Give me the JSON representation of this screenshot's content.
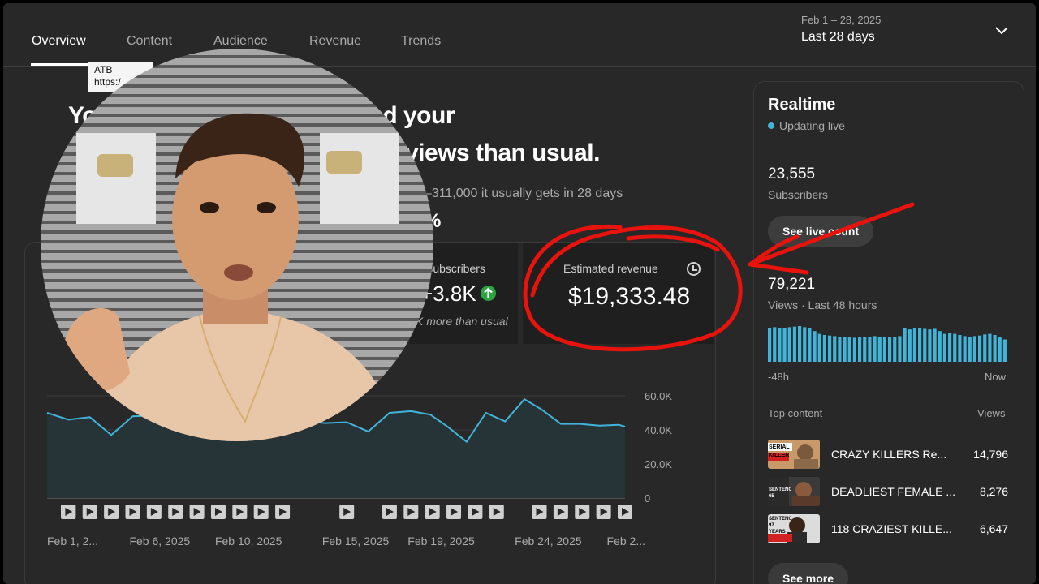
{
  "tabs": [
    {
      "label": "Overview"
    },
    {
      "label": "Content"
    },
    {
      "label": "Audience"
    },
    {
      "label": "Revenue"
    },
    {
      "label": "Trends"
    }
  ],
  "date_range": {
    "sub": "Feb 1 – 28, 2025",
    "main": "Last 28 days"
  },
  "tooltip": {
    "line1": "ATB",
    "line2": "https:/"
  },
  "headline": {
    "line1": "Yo          blishing more helped your",
    "line2": "views than usual.",
    "sub": "0–311,000 it usually gets in 28 days",
    "pct": "%"
  },
  "metrics": {
    "subscribers": {
      "label": "Subscribers",
      "value": "+3.8K",
      "note": "K more than usual",
      "label_prefix": "e"
    },
    "revenue": {
      "label": "Estimated revenue",
      "value": "$19,333.48"
    }
  },
  "chart_data": {
    "type": "area",
    "x_labels": [
      "Feb 1, 2...",
      "Feb 6, 2025",
      "Feb 10, 2025",
      "Feb 15, 2025",
      "Feb 19, 2025",
      "Feb 24, 2025",
      "Feb 2..."
    ],
    "y_ticks": [
      "60.0K",
      "40.0K",
      "20.0K",
      "0"
    ],
    "ylim": [
      0,
      60000
    ],
    "x": [
      1,
      2,
      3,
      4,
      5,
      6,
      7,
      8,
      9,
      10,
      11,
      12,
      13,
      14,
      15,
      16,
      17,
      18,
      18.9,
      19.7,
      20.6,
      21.5,
      22.4,
      23.3,
      24.1,
      25,
      25.9,
      26.8,
      27.7,
      28
    ],
    "values": [
      50000,
      46000,
      47500,
      37000,
      48000,
      48500,
      46000,
      44000,
      46500,
      45000,
      44000,
      44500,
      45000,
      44000,
      44500,
      39000,
      50000,
      51000,
      49000,
      42000,
      33000,
      50000,
      45000,
      58000,
      52000,
      43500,
      43500,
      42500,
      43000,
      42000
    ],
    "markers": [
      1,
      2,
      3,
      4,
      5,
      6,
      7,
      8,
      9,
      10,
      11,
      12,
      15,
      17,
      18,
      19,
      20,
      21,
      22,
      24,
      25,
      26,
      27,
      28
    ]
  },
  "realtime": {
    "title": "Realtime",
    "live": "Updating live",
    "subscribers": {
      "value": "23,555",
      "label": "Subscribers",
      "button": "See live count"
    },
    "views": {
      "value": "79,221",
      "label": "Views · Last 48 hours"
    },
    "spark": {
      "start": "-48h",
      "end": "Now",
      "values": [
        60,
        62,
        61,
        60,
        62,
        63,
        64,
        62,
        60,
        55,
        50,
        48,
        47,
        46,
        45,
        44,
        45,
        43,
        44,
        45,
        44,
        46,
        45,
        44,
        45,
        44,
        46,
        60,
        58,
        61,
        60,
        59,
        58,
        59,
        55,
        50,
        52,
        50,
        48,
        46,
        45,
        46,
        47,
        49,
        50,
        48,
        45,
        40
      ]
    },
    "top_content": {
      "header": "Top content",
      "views_header": "Views",
      "items": [
        {
          "title": "CRAZY KILLERS Re...",
          "views": "14,796",
          "thumb_text": "SERIAL KILLER"
        },
        {
          "title": "DEADLIEST FEMALE ...",
          "views": "8,276",
          "thumb_text": "SENTENCED 65 YEARS"
        },
        {
          "title": "118 CRAZIEST KILLE...",
          "views": "6,647",
          "thumb_text": "SENTENCED 97 YEARS"
        }
      ]
    },
    "see_more": "See more"
  },
  "colors": {
    "accent": "#41b4d9",
    "annotation_red": "#e8130c",
    "positive": "#2ba640"
  }
}
